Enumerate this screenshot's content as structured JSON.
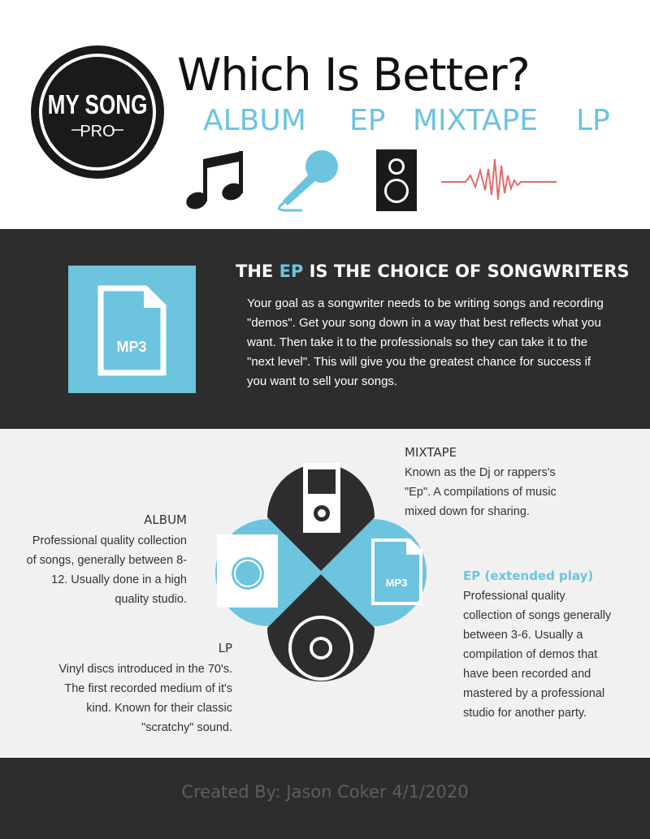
{
  "header": {
    "logo_text_top": "MY SONG",
    "logo_text_bottom": "PRO",
    "title": "Which Is Better?",
    "formats": [
      "ALBUM",
      "EP",
      "MIXTAPE",
      "LP"
    ],
    "icons": [
      "music-note-icon",
      "microphone-icon",
      "speaker-icon",
      "sound-wave-icon"
    ]
  },
  "feature": {
    "file_label": "MP3",
    "title_pre": "THE ",
    "title_accent": "EP",
    "title_post": " IS THE CHOICE OF SONGWRITERS",
    "body": "Your goal as a songwriter needs to be writing songs and recording \"demos\". Get your song down in a way that best reflects what you want. Then take it to the professionals so they can take it to the \"next level\". This will give you the greatest chance for success if you want to sell your songs."
  },
  "comparison": {
    "mixtape": {
      "title": "MIXTAPE",
      "text": "Known as the Dj or rappers's \"Ep\". A compilations of music mixed down for sharing."
    },
    "album": {
      "title": "ALBUM",
      "text": "Professional quality collection of songs, generally between 8-12. Usually done in a high quality studio."
    },
    "ep": {
      "title": "EP (extended play)",
      "text": "Professional quality collection of songs generally between 3-6. Usually a compilation of demos that have been recorded and mastered by a professional studio for another party.",
      "file_label": "MP3"
    },
    "lp": {
      "title": "LP",
      "text": "Vinyl discs introduced in the 70's. The first recorded medium of it's kind. Known for their classic \"scratchy\" sound."
    }
  },
  "footer": {
    "credit": "Created By: Jason Coker 4/1/2020"
  },
  "colors": {
    "accent": "#6cc4de",
    "dark": "#2d2d2d",
    "wave": "#e06c6c",
    "light_bg": "#f1f1f1"
  }
}
